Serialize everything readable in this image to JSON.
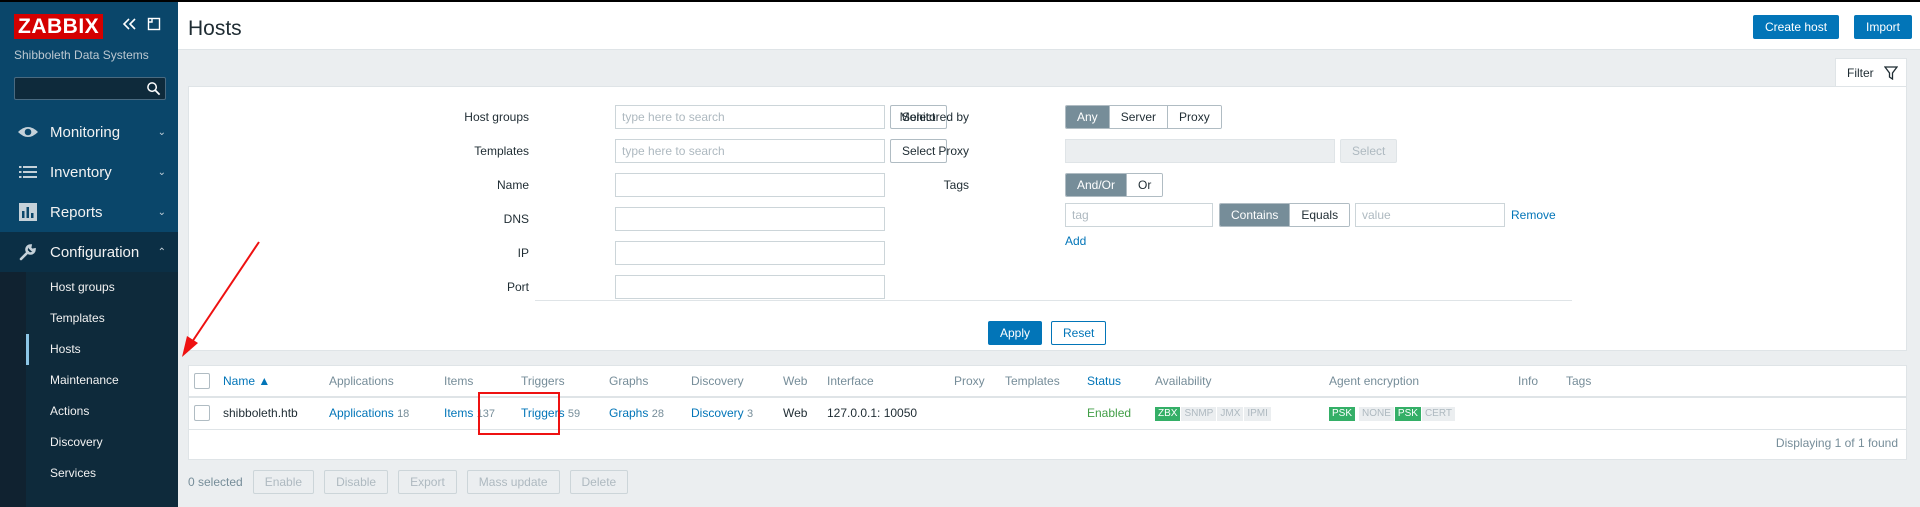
{
  "sidebar": {
    "logo": "ZABBIX",
    "company": "Shibboleth Data Systems",
    "collapse_icon": "double-chevron-left-icon",
    "kiosk_icon": "expand-icon",
    "search_placeholder": "",
    "menu": [
      {
        "label": "Monitoring",
        "icon": "eye-icon"
      },
      {
        "label": "Inventory",
        "icon": "list-icon"
      },
      {
        "label": "Reports",
        "icon": "bar-chart-icon"
      },
      {
        "label": "Configuration",
        "icon": "wrench-icon"
      }
    ],
    "submenu": [
      "Host groups",
      "Templates",
      "Hosts",
      "Maintenance",
      "Actions",
      "Discovery",
      "Services"
    ],
    "active_submenu": "Hosts"
  },
  "header": {
    "title": "Hosts",
    "create_host": "Create host",
    "import": "Import"
  },
  "filter": {
    "tab_label": "Filter",
    "host_groups_label": "Host groups",
    "host_groups_placeholder": "type here to search",
    "templates_label": "Templates",
    "templates_placeholder": "type here to search",
    "select_label": "Select",
    "name_label": "Name",
    "dns_label": "DNS",
    "ip_label": "IP",
    "port_label": "Port",
    "monitored_by_label": "Monitored by",
    "monitored_by_options": [
      "Any",
      "Server",
      "Proxy"
    ],
    "monitored_by_selected": "Any",
    "proxy_label": "Proxy",
    "tags_label": "Tags",
    "tags_options": [
      "And/Or",
      "Or"
    ],
    "tags_selected": "And/Or",
    "tag_placeholder": "tag",
    "tag_operator_options": [
      "Contains",
      "Equals"
    ],
    "tag_operator_selected": "Contains",
    "value_placeholder": "value",
    "remove_label": "Remove",
    "add_label": "Add",
    "apply_label": "Apply",
    "reset_label": "Reset"
  },
  "table": {
    "columns": [
      "Name ▲",
      "Applications",
      "Items",
      "Triggers",
      "Graphs",
      "Discovery",
      "Web",
      "Interface",
      "Proxy",
      "Templates",
      "Status",
      "Availability",
      "Agent encryption",
      "Info",
      "Tags"
    ],
    "rows": [
      {
        "name": "shibboleth.htb",
        "applications": "Applications",
        "applications_count": "18",
        "items": "Items",
        "items_count": "137",
        "triggers": "Triggers",
        "triggers_count": "59",
        "graphs": "Graphs",
        "graphs_count": "28",
        "discovery": "Discovery",
        "discovery_count": "3",
        "web": "Web",
        "interface": "127.0.0.1: 10050",
        "proxy": "",
        "templates": "",
        "status": "Enabled",
        "availability": [
          "ZBX",
          "SNMP",
          "JMX",
          "IPMI"
        ],
        "encryption": [
          "PSK",
          "NONE",
          "PSK",
          "CERT"
        ]
      }
    ],
    "displaying": "Displaying 1 of 1 found"
  },
  "footer": {
    "selected": "0 selected",
    "buttons": [
      "Enable",
      "Disable",
      "Export",
      "Mass update",
      "Delete"
    ]
  },
  "colors": {
    "sidebar_bg": "#0a466a",
    "accent": "#0275b8",
    "status_green": "#429e47",
    "badge_green": "#34af67",
    "annotation_red": "#ee1111"
  }
}
